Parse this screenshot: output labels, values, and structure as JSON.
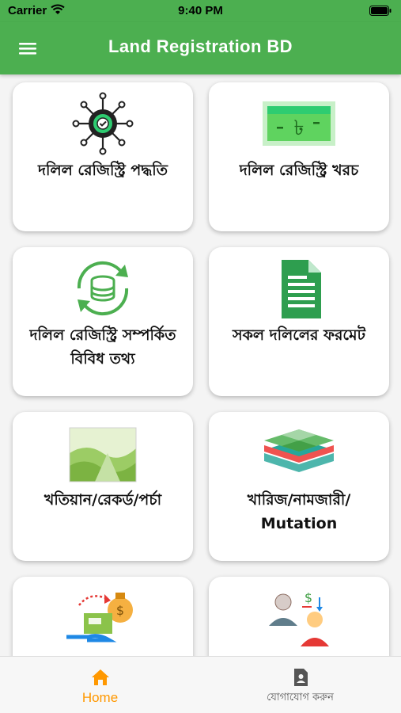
{
  "status_bar": {
    "carrier": "Carrier",
    "time": "9:40 PM"
  },
  "app_bar": {
    "title": "Land Registration BD"
  },
  "cards": [
    {
      "label": "দলিল রেজিস্ট্রি পদ্ধতি",
      "icon": "gear-network-icon"
    },
    {
      "label": "দলিল রেজিস্ট্রি খরচ",
      "icon": "taka-banknote-icon"
    },
    {
      "label": "দলিল রেজিস্ট্রি সম্পর্কিত বিবিধ তথ্য",
      "icon": "database-sync-icon"
    },
    {
      "label": "সকল দলিলের ফরমেট",
      "icon": "document-icon"
    },
    {
      "label": "খতিয়ান/রেকর্ড/পর্চা",
      "icon": "land-map-icon"
    },
    {
      "label": "খারিজ/নামজারী/ Mutation",
      "icon": "land-layers-icon"
    },
    {
      "label": "",
      "icon": "money-transfer-icon"
    },
    {
      "label": "",
      "icon": "people-exchange-icon"
    }
  ],
  "bottom_nav": {
    "home_label": "Home",
    "contact_label": "যোগাযোগ করুন"
  },
  "colors": {
    "primary": "#4caf50",
    "accent": "#ff9800"
  }
}
